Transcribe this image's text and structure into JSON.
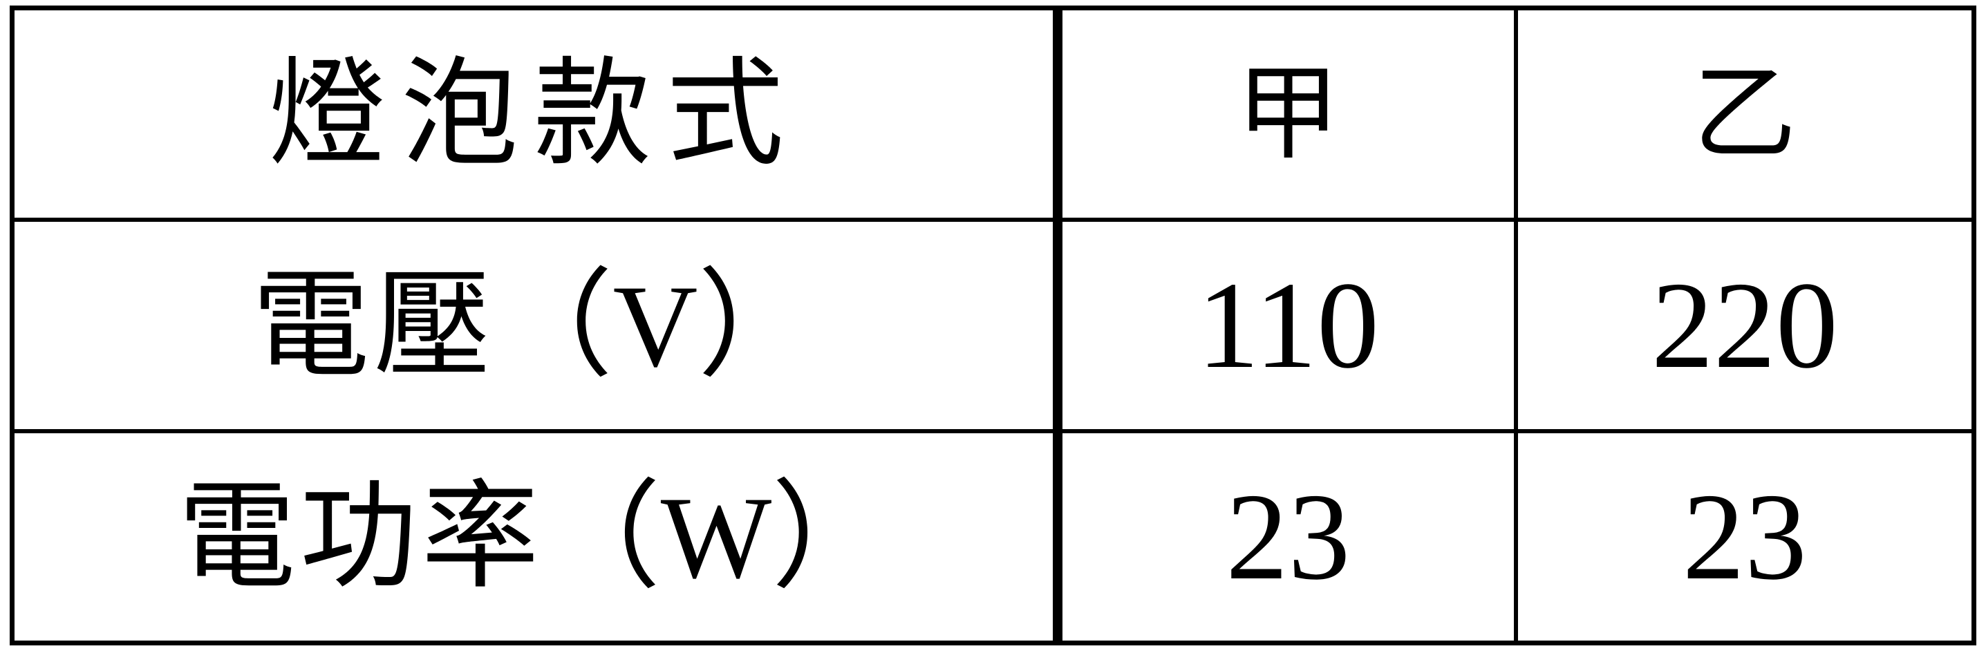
{
  "table": {
    "header": {
      "label": "燈泡款式",
      "columns": [
        "甲",
        "乙"
      ]
    },
    "rows": [
      {
        "label_cjk": "電壓",
        "label_open": "（",
        "label_unit": "V",
        "label_close": "）",
        "values": [
          "110",
          "220"
        ]
      },
      {
        "label_cjk": "電功率",
        "label_open": "（",
        "label_unit": "W",
        "label_close": "）",
        "values": [
          "23",
          "23"
        ]
      }
    ]
  }
}
